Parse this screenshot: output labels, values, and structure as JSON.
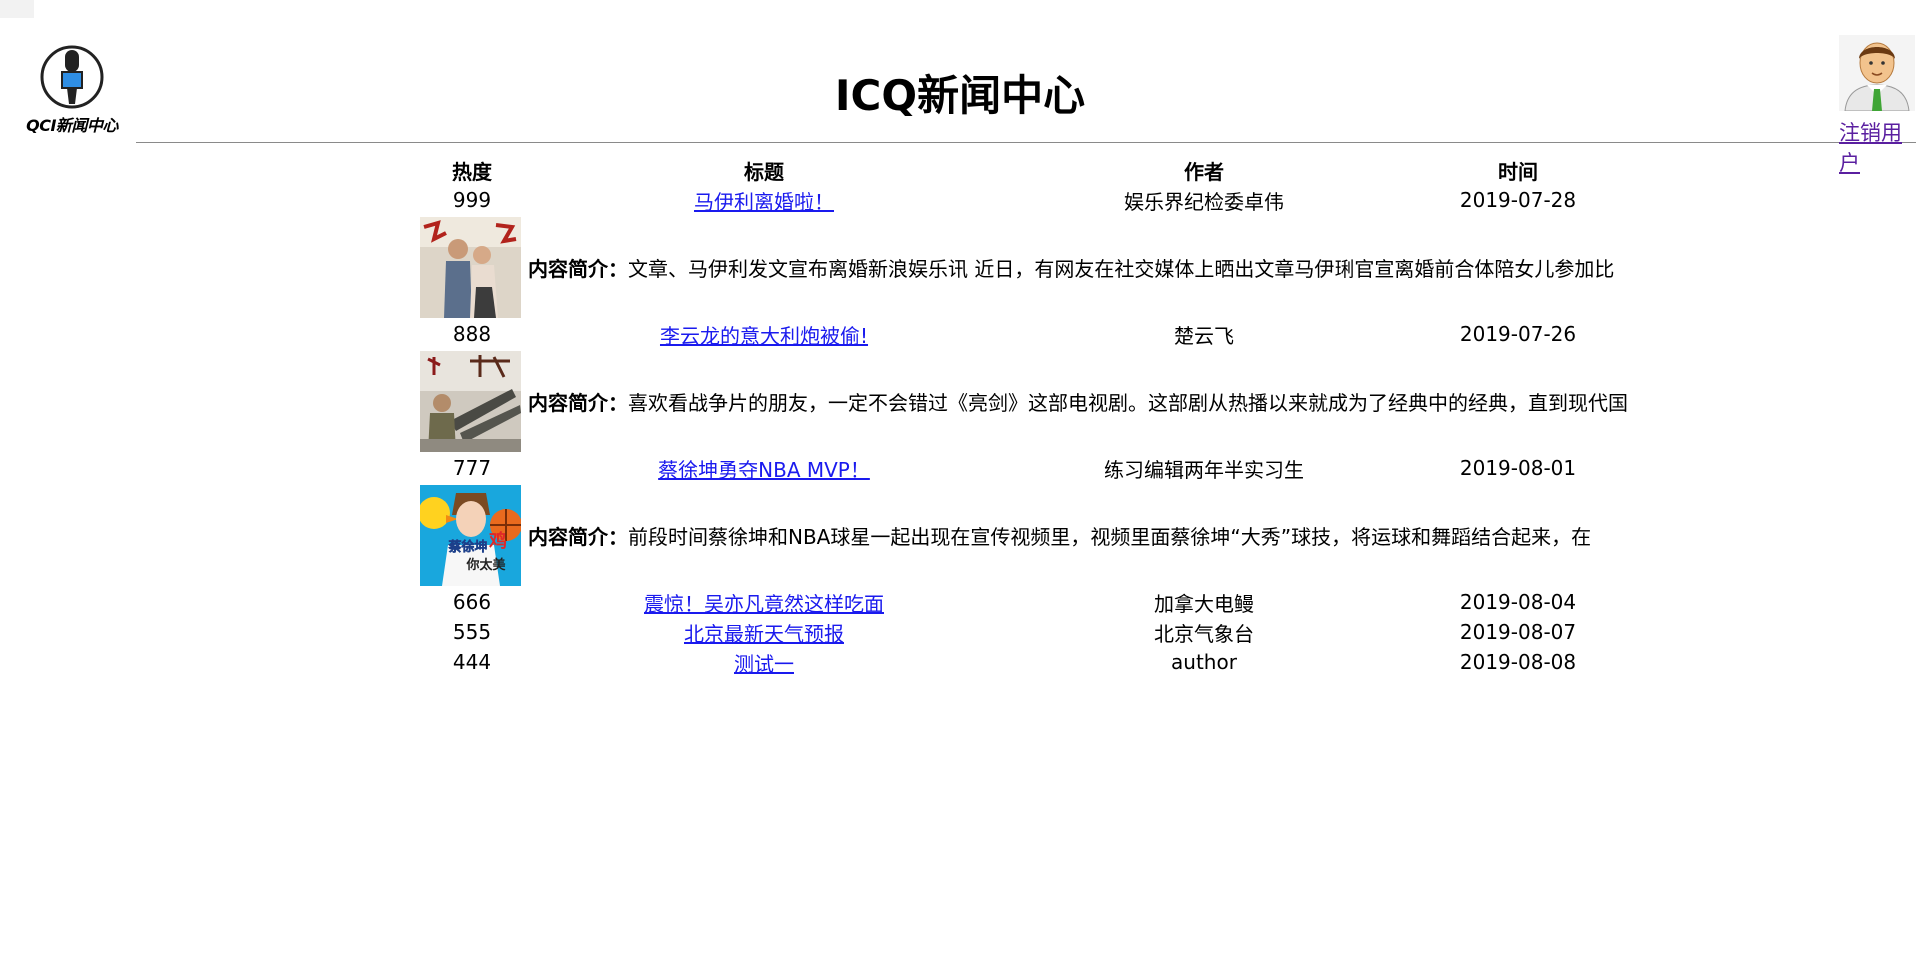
{
  "logo": {
    "caption": "QCI新闻中心"
  },
  "header": {
    "title": "ICQ新闻中心"
  },
  "user": {
    "logout_label": "注销用户"
  },
  "colors": {
    "link": "#1a1aee",
    "visited_link": "#5a1fa0",
    "divider": "#8a8a8a"
  },
  "table": {
    "columns": [
      "热度",
      "标题",
      "作者",
      "时间"
    ],
    "summary_label": "内容简介：",
    "rows": [
      {
        "hot": "999",
        "title": "马伊利离婚啦！",
        "author": "娱乐界纪检委卓伟",
        "date": "2019-07-28",
        "summary": "文章、马伊利发文宣布离婚新浪娱乐讯 近日，有网友在社交媒体上晒出文章马伊琍官宣离婚前合体陪女儿参加比",
        "thumb": "couple-photo"
      },
      {
        "hot": "888",
        "title": "李云龙的意大利炮被偷!",
        "author": "楚云飞",
        "date": "2019-07-26",
        "summary": "喜欢看战争片的朋友，一定不会错过《亮剑》这部电视剧。这部剧从热播以来就成为了经典中的经典，直到现代国",
        "thumb": "artillery-photo"
      },
      {
        "hot": "777",
        "title": "蔡徐坤勇夺NBA MVP！",
        "author": "练习编辑两年半实习生",
        "date": "2019-08-01",
        "summary": "前段时间蔡徐坤和NBA球星一起出现在宣传视频里，视频里面蔡徐坤“大秀”球技，将运球和舞蹈结合起来，在",
        "thumb": "basketball-meme-photo",
        "thumb_text": [
          "蔡徐坤",
          "鸡",
          "你太美"
        ]
      },
      {
        "hot": "666",
        "title": "震惊！吴亦凡竟然这样吃面",
        "author": "加拿大电鳗",
        "date": "2019-08-04"
      },
      {
        "hot": "555",
        "title": "北京最新天气预报",
        "author": "北京气象台",
        "date": "2019-08-07"
      },
      {
        "hot": "444",
        "title": "测试一",
        "author": "author",
        "date": "2019-08-08"
      }
    ]
  }
}
